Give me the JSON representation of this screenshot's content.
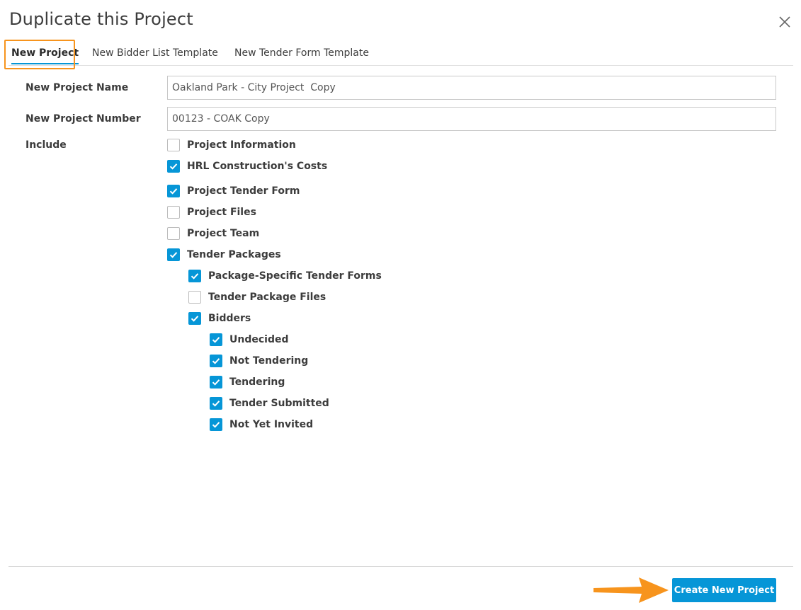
{
  "dialog": {
    "title": "Duplicate this Project",
    "close_icon": "close-icon"
  },
  "tabs": [
    {
      "label": "New Project",
      "active": true
    },
    {
      "label": "New Bidder List Template",
      "active": false
    },
    {
      "label": "New Tender Form Template",
      "active": false
    }
  ],
  "form": {
    "project_name_label": "New Project Name",
    "project_name_value": "Oakland Park - City Project  Copy",
    "project_number_label": "New Project Number",
    "project_number_value": "00123 - COAK Copy",
    "include_label": "Include",
    "options": [
      {
        "label": "Project Information",
        "checked": false,
        "level": 0
      },
      {
        "label": "HRL Construction's Costs",
        "checked": true,
        "level": 0
      },
      {
        "label": "Project Tender Form",
        "checked": true,
        "level": 0
      },
      {
        "label": "Project Files",
        "checked": false,
        "level": 0
      },
      {
        "label": "Project Team",
        "checked": false,
        "level": 0
      },
      {
        "label": "Tender Packages",
        "checked": true,
        "level": 0
      },
      {
        "label": "Package-Specific Tender Forms",
        "checked": true,
        "level": 1
      },
      {
        "label": "Tender Package Files",
        "checked": false,
        "level": 1
      },
      {
        "label": "Bidders",
        "checked": true,
        "level": 1
      },
      {
        "label": "Undecided",
        "checked": true,
        "level": 2
      },
      {
        "label": "Not Tendering",
        "checked": true,
        "level": 2
      },
      {
        "label": "Tendering",
        "checked": true,
        "level": 2
      },
      {
        "label": "Tender Submitted",
        "checked": true,
        "level": 2
      },
      {
        "label": "Not Yet Invited",
        "checked": true,
        "level": 2
      }
    ]
  },
  "footer": {
    "primary_label": "Create New Project"
  },
  "colors": {
    "accent": "#0696d7",
    "highlight": "#f7941d"
  }
}
